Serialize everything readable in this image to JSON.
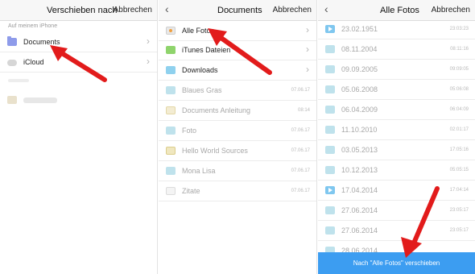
{
  "panel1": {
    "title": "Verschieben nach",
    "cancel": "Abbrechen",
    "section": "Auf meinem iPhone",
    "items": [
      {
        "label": "Documents",
        "icon": "folder-icon"
      },
      {
        "label": "iCloud",
        "icon": "cloud-icon"
      }
    ]
  },
  "panel2": {
    "title": "Documents",
    "cancel": "Abbrechen",
    "items": [
      {
        "label": "Alle Fotos",
        "icon": "photos-icon",
        "date": ""
      },
      {
        "label": "iTunes Dateien",
        "icon": "folder-icon",
        "date": ""
      },
      {
        "label": "Downloads",
        "icon": "folder-icon",
        "date": ""
      },
      {
        "label": "Blaues Gras",
        "icon": "image-icon",
        "date": "07.06.17"
      },
      {
        "label": "Documents Anleitung",
        "icon": "document-icon",
        "date": "08:14"
      },
      {
        "label": "Foto",
        "icon": "image-icon",
        "date": "07.06.17"
      },
      {
        "label": "Hello World Sources",
        "icon": "zip-icon",
        "date": "07.06.17"
      },
      {
        "label": "Mona Lisa",
        "icon": "image-icon",
        "date": "07.06.17"
      },
      {
        "label": "Zitate",
        "icon": "text-file-icon",
        "date": "07.06.17"
      }
    ]
  },
  "panel3": {
    "title": "Alle Fotos",
    "cancel": "Abbrechen",
    "items": [
      {
        "label": "23.02.1951",
        "time": "23:03:23",
        "icon": "video-icon"
      },
      {
        "label": "08.11.2004",
        "time": "08:11:16",
        "icon": "image-icon"
      },
      {
        "label": "09.09.2005",
        "time": "09:09:05",
        "icon": "image-icon"
      },
      {
        "label": "05.06.2008",
        "time": "05:06:08",
        "icon": "image-icon"
      },
      {
        "label": "06.04.2009",
        "time": "06:04:09",
        "icon": "image-icon"
      },
      {
        "label": "11.10.2010",
        "time": "02:01:17",
        "icon": "image-icon"
      },
      {
        "label": "03.05.2013",
        "time": "17:05:16",
        "icon": "image-icon"
      },
      {
        "label": "10.12.2013",
        "time": "05:05:15",
        "icon": "image-icon"
      },
      {
        "label": "17.04.2014",
        "time": "17:04:14",
        "icon": "video-icon"
      },
      {
        "label": "27.06.2014",
        "time": "23:05:17",
        "icon": "image-icon"
      },
      {
        "label": "27.06.2014",
        "time": "23:05:17",
        "icon": "image-icon"
      },
      {
        "label": "28.06.2014",
        "time": "",
        "icon": "image-icon"
      }
    ],
    "move_button": "Nach \"Alle Fotos\" verschieben"
  },
  "colors": {
    "accent": "#3c9df1",
    "arrow": "#e21b1b",
    "folder": "#8e9bea"
  }
}
